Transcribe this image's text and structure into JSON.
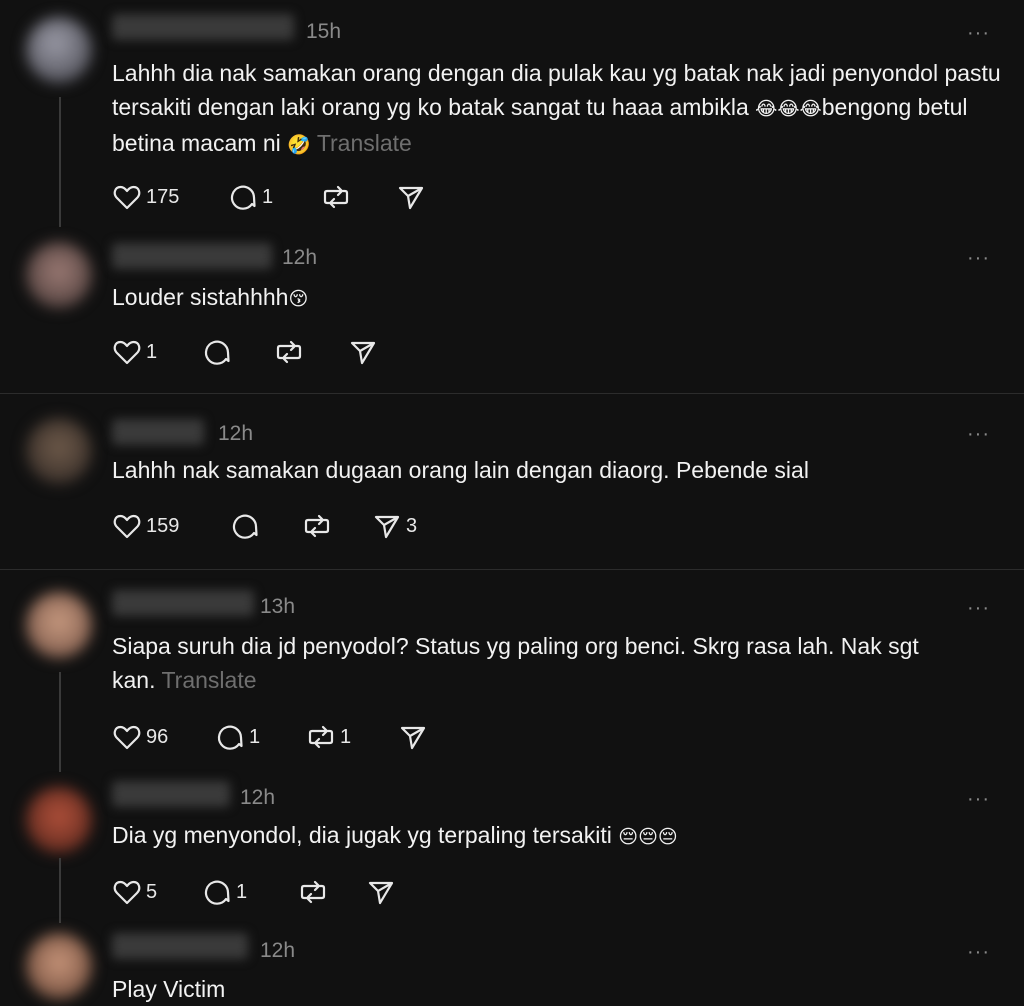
{
  "more_label": "···",
  "colors": {
    "background": "#111111",
    "text": "#f2f2f2",
    "muted": "#8a8a8a",
    "translate": "#6f6f6f"
  },
  "icons": [
    "heart-icon",
    "comment-icon",
    "repost-icon",
    "share-icon",
    "more-icon"
  ],
  "replies": [
    {
      "time": "15h",
      "text": "Lahhh dia nak samakan orang dengan dia pulak kau yg batak nak jadi penyondol pastu tersakiti dengan laki orang yg ko batak sangat tu haaa ambikla ",
      "emoji_a": "😂😂😂",
      "text_b": "bengong betul betina macam ni ",
      "emoji_b": "🤣",
      "translate": "Translate",
      "likes": "175",
      "comments": "1",
      "reposts": "",
      "shares": ""
    },
    {
      "time": "12h",
      "text": "Louder sistahhhh",
      "emoji_a": "😚",
      "likes": "1",
      "comments": "",
      "reposts": "",
      "shares": ""
    },
    {
      "time": "12h",
      "text": "Lahhh nak samakan dugaan orang lain dengan diaorg. Pebende sial",
      "likes": "159",
      "comments": "",
      "reposts": "",
      "shares": "3"
    },
    {
      "time": "13h",
      "text": "Siapa suruh dia jd penyodol? Status yg paling org benci. Skrg rasa lah. Nak sgt kan.",
      "translate": "Translate",
      "likes": "96",
      "comments": "1",
      "reposts": "1",
      "shares": ""
    },
    {
      "time": "12h",
      "text": "Dia yg menyondol, dia jugak yg terpaling tersakiti ",
      "emoji_a": "😔😔😔",
      "likes": "5",
      "comments": "1",
      "reposts": "",
      "shares": ""
    },
    {
      "time": "12h",
      "text": "Play Victim"
    }
  ]
}
